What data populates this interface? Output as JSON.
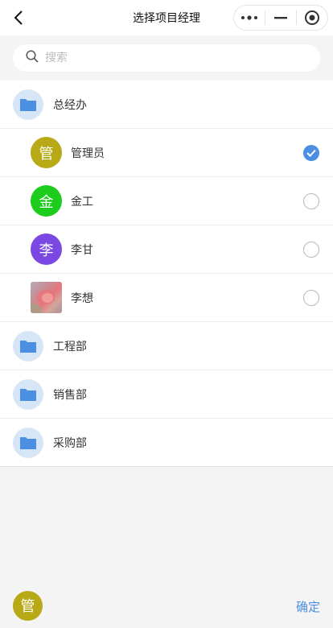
{
  "nav": {
    "title": "选择项目经理",
    "icons": {
      "back": "chevron-left-icon",
      "more": "more-dots-icon",
      "minimize": "minimize-icon",
      "close": "target-close-icon"
    }
  },
  "search": {
    "placeholder": "搜索",
    "value": ""
  },
  "colors": {
    "accent": "#4a8fe2",
    "folder_bg": "#d6e6f7",
    "avatar_guan": "#b8a916",
    "avatar_jin": "#1dcc1d",
    "avatar_li": "#7b48e4"
  },
  "list": {
    "dept1": {
      "label": "总经办"
    },
    "members": [
      {
        "avatar_text": "管",
        "label": "管理员",
        "checked": true
      },
      {
        "avatar_text": "金",
        "label": "金工",
        "checked": false
      },
      {
        "avatar_text": "李",
        "label": "李甘",
        "checked": false
      },
      {
        "avatar_text": "",
        "label": "李想",
        "checked": false
      }
    ],
    "dept2": {
      "label": "工程部"
    },
    "dept3": {
      "label": "销售部"
    },
    "dept4": {
      "label": "采购部"
    }
  },
  "footer": {
    "selected_avatar_text": "管",
    "confirm_label": "确定"
  }
}
